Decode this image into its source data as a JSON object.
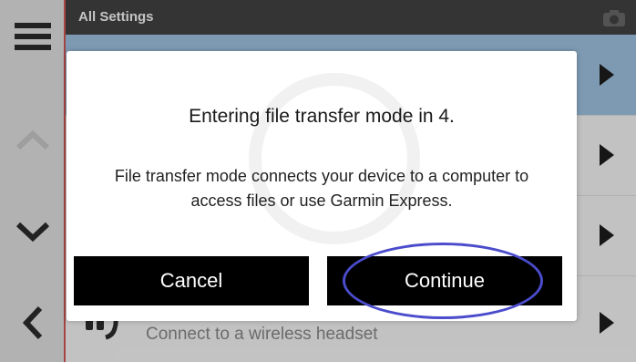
{
  "header": {
    "title": "All Settings"
  },
  "background_list": {
    "rows": [
      {
        "label": ""
      },
      {
        "label": ""
      },
      {
        "label": ""
      },
      {
        "label": "Connect to a wireless headset"
      }
    ]
  },
  "dialog": {
    "title": "Entering file transfer mode in 4.",
    "body": "File transfer mode connects your device to a computer to access files or use Garmin Express.",
    "cancel_label": "Cancel",
    "continue_label": "Continue"
  },
  "icons": {
    "menu": "hamburger-menu-icon",
    "up": "chevron-up-icon",
    "down": "chevron-down-icon",
    "back": "back-arrow-icon",
    "row_arrow": "play-arrow-icon",
    "headset": "headset-icon",
    "camera": "camera-icon"
  },
  "colors": {
    "accent_red": "#c5413f",
    "highlight_row": "#8fb7d8",
    "annotation_circle": "#4b4ccc"
  }
}
